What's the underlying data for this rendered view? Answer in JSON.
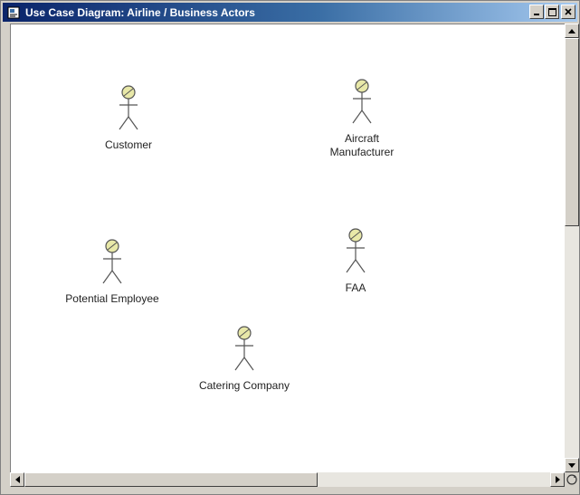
{
  "window": {
    "title": "Use Case Diagram: Airline / Business Actors",
    "title_icon": "document-icon",
    "controls": {
      "minimize": "_",
      "maximize": "□",
      "close": "×"
    }
  },
  "actors": [
    {
      "name": "Customer"
    },
    {
      "name": "Aircraft\nManufacturer"
    },
    {
      "name": "Potential Employee"
    },
    {
      "name": "FAA"
    },
    {
      "name": "Catering Company"
    }
  ],
  "colors": {
    "actor_head": "#e8e8a8",
    "actor_stroke": "#555555",
    "title_gradient_start": "#0a246a",
    "title_gradient_end": "#a6caf0"
  }
}
